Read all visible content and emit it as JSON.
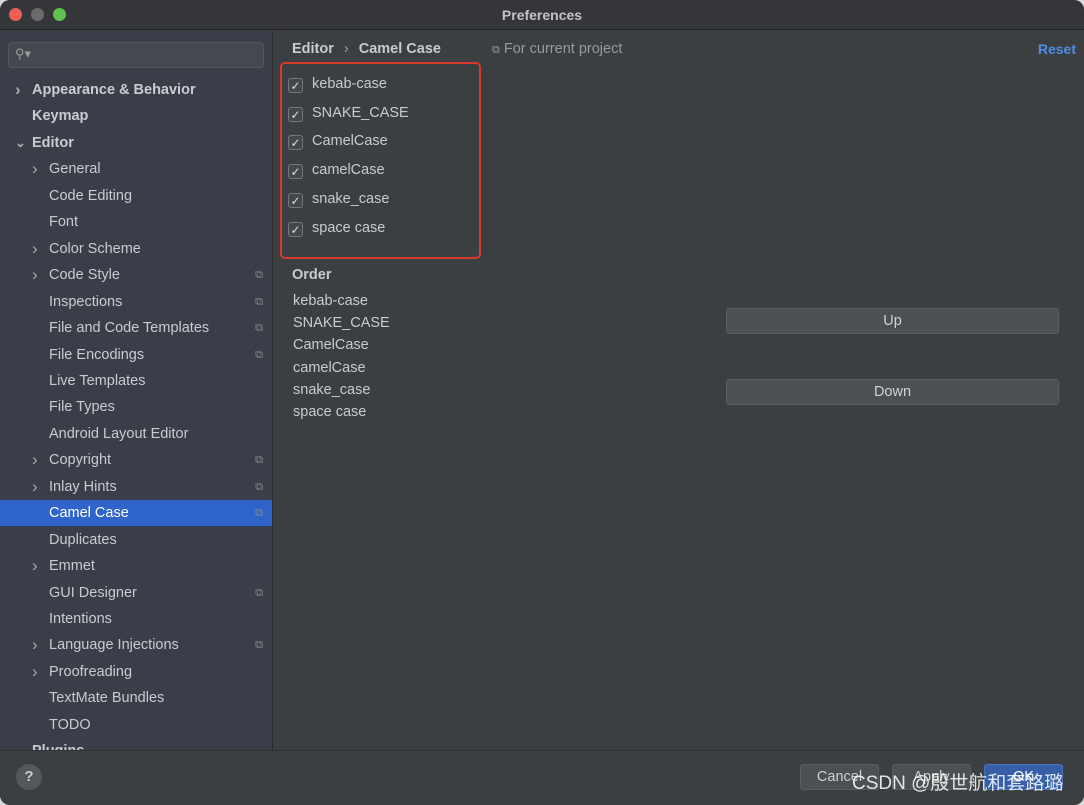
{
  "window": {
    "title": "Preferences"
  },
  "sidebar": {
    "search_placeholder": "",
    "items": [
      {
        "label": "Appearance & Behavior",
        "level": 0,
        "chevron": "right",
        "bold": true
      },
      {
        "label": "Keymap",
        "level": 0,
        "bold": true
      },
      {
        "label": "Editor",
        "level": 0,
        "chevron": "down",
        "bold": true
      },
      {
        "label": "General",
        "level": 1,
        "chevron": "right"
      },
      {
        "label": "Code Editing",
        "level": 1
      },
      {
        "label": "Font",
        "level": 1
      },
      {
        "label": "Color Scheme",
        "level": 1,
        "chevron": "right"
      },
      {
        "label": "Code Style",
        "level": 1,
        "chevron": "right",
        "project": true
      },
      {
        "label": "Inspections",
        "level": 1,
        "project": true
      },
      {
        "label": "File and Code Templates",
        "level": 1,
        "project": true
      },
      {
        "label": "File Encodings",
        "level": 1,
        "project": true
      },
      {
        "label": "Live Templates",
        "level": 1
      },
      {
        "label": "File Types",
        "level": 1
      },
      {
        "label": "Android Layout Editor",
        "level": 1
      },
      {
        "label": "Copyright",
        "level": 1,
        "chevron": "right",
        "project": true
      },
      {
        "label": "Inlay Hints",
        "level": 1,
        "chevron": "right",
        "project": true
      },
      {
        "label": "Camel Case",
        "level": 1,
        "project": true,
        "selected": true
      },
      {
        "label": "Duplicates",
        "level": 1
      },
      {
        "label": "Emmet",
        "level": 1,
        "chevron": "right"
      },
      {
        "label": "GUI Designer",
        "level": 1,
        "project": true
      },
      {
        "label": "Intentions",
        "level": 1
      },
      {
        "label": "Language Injections",
        "level": 1,
        "chevron": "right",
        "project": true
      },
      {
        "label": "Proofreading",
        "level": 1,
        "chevron": "right"
      },
      {
        "label": "TextMate Bundles",
        "level": 1
      },
      {
        "label": "TODO",
        "level": 1
      },
      {
        "label": "Plugins",
        "level": 0,
        "bold": true
      }
    ]
  },
  "main": {
    "breadcrumb": [
      "Editor",
      "Camel Case"
    ],
    "scope": "For current project",
    "reset": "Reset",
    "checkboxes": [
      {
        "label": "kebab-case",
        "checked": true
      },
      {
        "label": "SNAKE_CASE",
        "checked": true
      },
      {
        "label": "CamelCase",
        "checked": true
      },
      {
        "label": "camelCase",
        "checked": true
      },
      {
        "label": "snake_case",
        "checked": true
      },
      {
        "label": "space case",
        "checked": true
      }
    ],
    "order_title": "Order",
    "order": [
      "kebab-case",
      "SNAKE_CASE",
      "CamelCase",
      "camelCase",
      "snake_case",
      "space case"
    ],
    "up": "Up",
    "down": "Down"
  },
  "footer": {
    "help": "?",
    "cancel": "Cancel",
    "apply": "Apply",
    "ok": "OK"
  },
  "watermark": "CSDN @殷世航和套路璐",
  "colors": {
    "selection": "#2f65ca",
    "highlight_box": "#d83a2e",
    "link": "#4b8ee8"
  }
}
